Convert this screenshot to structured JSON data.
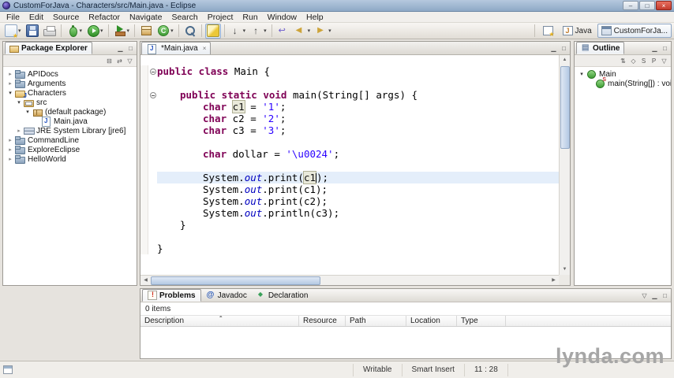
{
  "window": {
    "title": "CustomForJava - Characters/src/Main.java - Eclipse"
  },
  "menubar": {
    "items": [
      "File",
      "Edit",
      "Source",
      "Refactor",
      "Navigate",
      "Search",
      "Project",
      "Run",
      "Window",
      "Help"
    ]
  },
  "toolbar": {
    "buttons": [
      {
        "name": "new-wizard",
        "icon": "new",
        "dropdown": true
      },
      {
        "name": "save",
        "icon": "save"
      },
      {
        "name": "print",
        "icon": "print",
        "group_end": true
      },
      {
        "name": "debug",
        "icon": "debug",
        "dropdown": true
      },
      {
        "name": "run",
        "icon": "run",
        "dropdown": true,
        "group_end": true
      },
      {
        "name": "run-external-tools",
        "icon": "ext",
        "dropdown": true,
        "group_end": true
      },
      {
        "name": "new-java-package",
        "icon": "pkg"
      },
      {
        "name": "new-java-class",
        "icon": "cls",
        "dropdown": true,
        "group_end": true
      },
      {
        "name": "search",
        "icon": "search",
        "group_end": true
      },
      {
        "name": "mark-occurrences",
        "icon": "marker",
        "pressed": true,
        "group_end": true
      },
      {
        "name": "next-annotation",
        "icon": "next",
        "dropdown": true
      },
      {
        "name": "previous-annotation",
        "icon": "prev",
        "dropdown": true,
        "group_end": true
      },
      {
        "name": "last-edit-location",
        "icon": "lastedit"
      },
      {
        "name": "back",
        "icon": "back",
        "dropdown": true
      },
      {
        "name": "forward",
        "icon": "fwd",
        "dropdown": true
      }
    ],
    "perspectives": [
      {
        "label": "Java",
        "icon": "java",
        "active": false
      },
      {
        "label": "CustomForJa...",
        "icon": "custom",
        "active": true
      }
    ]
  },
  "package_explorer": {
    "title": "Package Explorer",
    "tree": [
      {
        "label": "APIDocs",
        "depth": 0,
        "icon": "project-closed",
        "expander": "collapsed"
      },
      {
        "label": "Arguments",
        "depth": 0,
        "icon": "project-closed",
        "expander": "collapsed"
      },
      {
        "label": "Characters",
        "depth": 0,
        "icon": "project-open",
        "expander": "expanded"
      },
      {
        "label": "src",
        "depth": 1,
        "icon": "src-folder",
        "expander": "expanded"
      },
      {
        "label": "(default package)",
        "depth": 2,
        "icon": "package",
        "expander": "expanded"
      },
      {
        "label": "Main.java",
        "depth": 3,
        "icon": "java-file",
        "expander": "none"
      },
      {
        "label": "JRE System Library [jre6]",
        "depth": 1,
        "icon": "library",
        "expander": "collapsed"
      },
      {
        "label": "CommandLine",
        "depth": 0,
        "icon": "project-closed",
        "expander": "collapsed"
      },
      {
        "label": "ExploreEclipse",
        "depth": 0,
        "icon": "project-closed",
        "expander": "collapsed"
      },
      {
        "label": "HelloWorld",
        "depth": 0,
        "icon": "project-closed",
        "expander": "collapsed"
      }
    ]
  },
  "editor": {
    "tab": "*Main.java",
    "lines": [
      {
        "indent": 0,
        "fold": true,
        "tokens": [
          {
            "y": "k",
            "t": "public class"
          },
          {
            "y": "p",
            "t": " Main {"
          }
        ]
      },
      {
        "indent": 0,
        "tokens": []
      },
      {
        "indent": 1,
        "fold": true,
        "tokens": [
          {
            "y": "k",
            "t": "public static void"
          },
          {
            "y": "p",
            "t": " main(String[] args) {"
          }
        ]
      },
      {
        "indent": 2,
        "tokens": [
          {
            "y": "k",
            "t": "char"
          },
          {
            "y": "p",
            "t": " "
          },
          {
            "y": "o",
            "t": "c1"
          },
          {
            "y": "p",
            "t": " = "
          },
          {
            "y": "s",
            "t": "'1'"
          },
          {
            "y": "p",
            "t": ";"
          }
        ]
      },
      {
        "indent": 2,
        "tokens": [
          {
            "y": "k",
            "t": "char"
          },
          {
            "y": "p",
            "t": " c2 = "
          },
          {
            "y": "s",
            "t": "'2'"
          },
          {
            "y": "p",
            "t": ";"
          }
        ]
      },
      {
        "indent": 2,
        "tokens": [
          {
            "y": "k",
            "t": "char"
          },
          {
            "y": "p",
            "t": " c3 = "
          },
          {
            "y": "s",
            "t": "'3'"
          },
          {
            "y": "p",
            "t": ";"
          }
        ]
      },
      {
        "indent": 0,
        "tokens": []
      },
      {
        "indent": 2,
        "tokens": [
          {
            "y": "k",
            "t": "char"
          },
          {
            "y": "p",
            "t": " dollar = "
          },
          {
            "y": "s",
            "t": "'\\u0024'"
          },
          {
            "y": "p",
            "t": ";"
          }
        ]
      },
      {
        "indent": 0,
        "tokens": []
      },
      {
        "indent": 2,
        "current": true,
        "tokens": [
          {
            "y": "p",
            "t": "System."
          },
          {
            "y": "f",
            "t": "out"
          },
          {
            "y": "p",
            "t": ".print("
          },
          {
            "y": "o",
            "t": "c1",
            "caret": true
          },
          {
            "y": "p",
            "t": ");"
          }
        ]
      },
      {
        "indent": 2,
        "tokens": [
          {
            "y": "p",
            "t": "System."
          },
          {
            "y": "f",
            "t": "out"
          },
          {
            "y": "p",
            "t": ".print(c1);"
          }
        ]
      },
      {
        "indent": 2,
        "tokens": [
          {
            "y": "p",
            "t": "System."
          },
          {
            "y": "f",
            "t": "out"
          },
          {
            "y": "p",
            "t": ".print(c2);"
          }
        ]
      },
      {
        "indent": 2,
        "tokens": [
          {
            "y": "p",
            "t": "System."
          },
          {
            "y": "f",
            "t": "out"
          },
          {
            "y": "p",
            "t": ".println(c3);"
          }
        ]
      },
      {
        "indent": 1,
        "tokens": [
          {
            "y": "p",
            "t": "}"
          }
        ]
      },
      {
        "indent": 0,
        "tokens": []
      },
      {
        "indent": 0,
        "tokens": [
          {
            "y": "p",
            "t": "}"
          }
        ]
      }
    ]
  },
  "outline": {
    "title": "Outline",
    "items": [
      {
        "label": "Main",
        "depth": 0,
        "icon": "class",
        "expander": "expanded"
      },
      {
        "label": "main(String[]) : void",
        "depth": 1,
        "icon": "method-static",
        "expander": "none"
      }
    ]
  },
  "problems": {
    "tabs": [
      {
        "label": "Problems",
        "icon": "problems",
        "active": true
      },
      {
        "label": "Javadoc",
        "icon": "javadoc",
        "active": false
      },
      {
        "label": "Declaration",
        "icon": "declaration",
        "active": false
      }
    ],
    "summary": "0 items",
    "columns": [
      "Description",
      "Resource",
      "Path",
      "Location",
      "Type"
    ]
  },
  "statusbar": {
    "writable": "Writable",
    "mode": "Smart Insert",
    "caret_position": "11 : 28"
  },
  "watermark": {
    "text": "lynda.com"
  },
  "colors": {
    "keyword": "#7f0055",
    "string": "#2a00ff",
    "static_field": "#0000c0",
    "current_line": "#e4eefa",
    "occurrence": "#e9e9da",
    "titlebar": "#8ea9c6",
    "close_button": "#c23b2e"
  }
}
